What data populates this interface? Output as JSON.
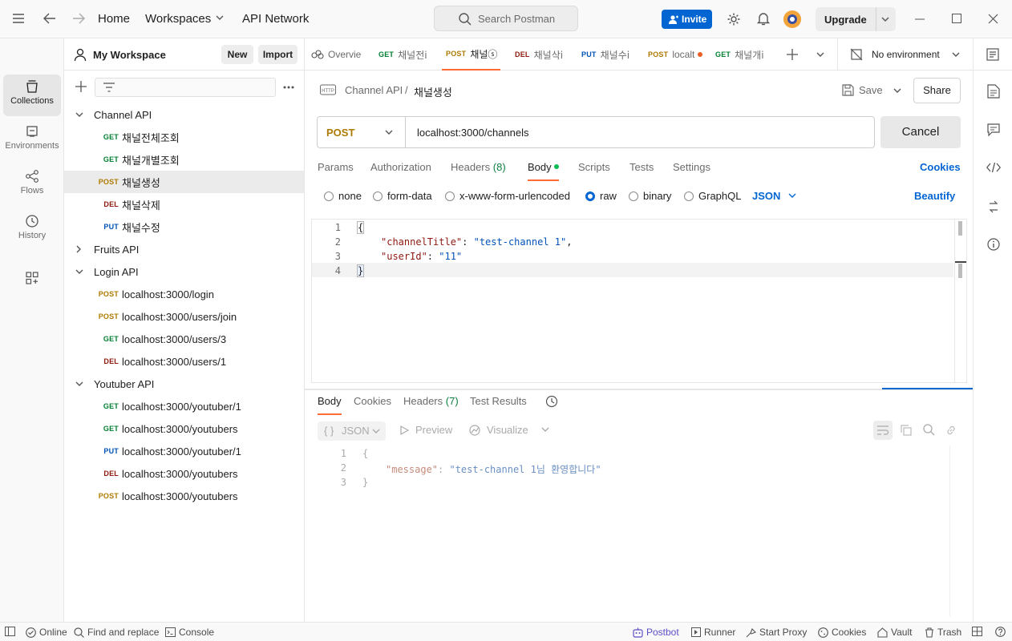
{
  "titlebar": {
    "nav": [
      "Home",
      "Workspaces",
      "API Network"
    ],
    "search_placeholder": "Search Postman",
    "invite_label": "Invite",
    "upgrade_label": "Upgrade"
  },
  "rail": [
    {
      "label": "Collections",
      "icon": "collections-icon"
    },
    {
      "label": "Environments",
      "icon": "environments-icon"
    },
    {
      "label": "Flows",
      "icon": "flows-icon"
    },
    {
      "label": "History",
      "icon": "history-icon"
    }
  ],
  "workspace": {
    "name": "My Workspace",
    "new_label": "New",
    "import_label": "Import"
  },
  "collections": [
    {
      "name": "Channel API",
      "expanded": true,
      "requests": [
        {
          "method": "GET",
          "name": "채널전체조회"
        },
        {
          "method": "GET",
          "name": "채널개별조회"
        },
        {
          "method": "POST",
          "name": "채널생성",
          "selected": true
        },
        {
          "method": "DEL",
          "name": "채널삭제"
        },
        {
          "method": "PUT",
          "name": "채널수정"
        }
      ]
    },
    {
      "name": "Fruits API",
      "expanded": false,
      "requests": []
    },
    {
      "name": "Login API",
      "expanded": true,
      "requests": [
        {
          "method": "POST",
          "name": "localhost:3000/login"
        },
        {
          "method": "POST",
          "name": "localhost:3000/users/join"
        },
        {
          "method": "GET",
          "name": "localhost:3000/users/3"
        },
        {
          "method": "DEL",
          "name": "localhost:3000/users/1"
        }
      ]
    },
    {
      "name": "Youtuber API",
      "expanded": true,
      "requests": [
        {
          "method": "GET",
          "name": "localhost:3000/youtuber/1"
        },
        {
          "method": "GET",
          "name": "localhost:3000/youtubers"
        },
        {
          "method": "PUT",
          "name": "localhost:3000/youtuber/1"
        },
        {
          "method": "DEL",
          "name": "localhost:3000/youtubers"
        },
        {
          "method": "POST",
          "name": "localhost:3000/youtubers"
        }
      ]
    }
  ],
  "tabs": [
    {
      "method": "",
      "label": "Overvie",
      "dot": false
    },
    {
      "method": "GET",
      "label": "채널전ⅰ",
      "dot": false
    },
    {
      "method": "POST",
      "label": "채널ⓢ",
      "dot": true,
      "active": true
    },
    {
      "method": "DEL",
      "label": "채널삭ⅰ",
      "dot": false
    },
    {
      "method": "PUT",
      "label": "채널수ⅰ",
      "dot": false
    },
    {
      "method": "POST",
      "label": "localt",
      "dot": true
    },
    {
      "method": "GET",
      "label": "채널개ⅰ",
      "dot": false
    }
  ],
  "environment": "No environment",
  "request": {
    "breadcrumb_parent": "Channel API",
    "breadcrumb_sep": "/",
    "title": "채널생성",
    "save_label": "Save",
    "share_label": "Share",
    "method": "POST",
    "url": "localhost:3000/channels",
    "send_label": "Cancel",
    "tabs": [
      "Params",
      "Authorization",
      "Headers",
      "Body",
      "Scripts",
      "Tests",
      "Settings"
    ],
    "headers_count": "(8)",
    "cookies_label": "Cookies",
    "body_types": [
      "none",
      "form-data",
      "x-www-form-urlencoded",
      "raw",
      "binary",
      "GraphQL"
    ],
    "body_format": "JSON",
    "beautify_label": "Beautify",
    "body_lines": [
      "{",
      "\"channelTitle\"",
      ": ",
      "\"test-channel 1\"",
      ",",
      "\"userId\"",
      ": ",
      "\"11\"",
      "}"
    ]
  },
  "response": {
    "tabs": [
      "Body",
      "Cookies",
      "Headers",
      "Test Results"
    ],
    "headers_count": "(7)",
    "format": "JSON",
    "preview_label": "Preview",
    "visualize_label": "Visualize",
    "lines": [
      "{",
      "\"message\"",
      ": ",
      "\"test-channel 1님 환영합니다\"",
      "}"
    ]
  },
  "statusbar": {
    "online": "Online",
    "find_replace": "Find and replace",
    "console": "Console",
    "postbot": "Postbot",
    "runner": "Runner",
    "start_proxy": "Start Proxy",
    "cookies": "Cookies",
    "vault": "Vault",
    "trash": "Trash"
  },
  "colors": {
    "accent": "#ff6c37",
    "primary": "#0265d2",
    "get": "#007f31",
    "post": "#ad7a03",
    "del": "#8e1a10",
    "put": "#0053b8"
  }
}
